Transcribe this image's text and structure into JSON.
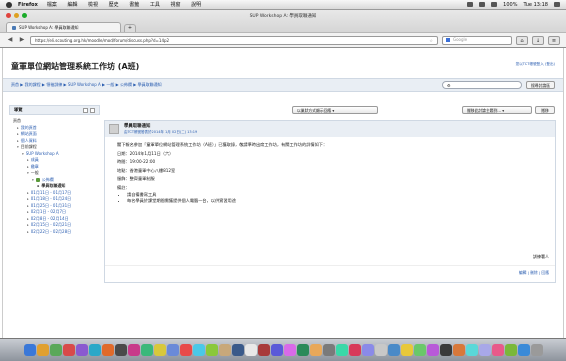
{
  "mac_menubar": {
    "app_name": "Firefox",
    "menus": [
      "檔案",
      "編輯",
      "檢視",
      "歷史",
      "書籤",
      "工具",
      "視窗",
      "說明"
    ],
    "status": "100%",
    "clock": "Tue 13:18"
  },
  "browser": {
    "window_title": "SUP Workshop A: 學員取聯通知",
    "tab_label": "SUP Workshop A: 學員取聯通知",
    "new_tab": "+",
    "url": "https://eli.scouting.org.hk/moodle/mod/forum/discuss.php?d=14p2",
    "search_placeholder": "Google"
  },
  "site": {
    "title": "童軍單位網站管理系統工作坊 (A班)",
    "login_info": "您以TCT帳號登入 (登出)",
    "breadcrumb": "頁首 ▶ 我的課程 ▶ 領袖訓練 ▶ SUP Workshop A ▶ 一般 ▶ 公佈欄 ▶ 學員取聯通知",
    "search_button": "搜尋討論區"
  },
  "sidebar": {
    "title": "導覽",
    "items": [
      {
        "label": "頁首"
      },
      {
        "label": "我的頁首"
      },
      {
        "label": "網站頁面"
      },
      {
        "label": "個人資料"
      },
      {
        "label": "目前課程"
      },
      {
        "label": "SUP Workshop A"
      },
      {
        "label": "成員"
      },
      {
        "label": "繳章"
      },
      {
        "label": "一般"
      },
      {
        "label": "公佈欄"
      },
      {
        "label": "學員取聯通知"
      },
      {
        "label": "01月11日 - 01月17日"
      },
      {
        "label": "01月18日 - 01月24日"
      },
      {
        "label": "01月25日 - 01月31日"
      },
      {
        "label": "02月1日 - 02月7日"
      },
      {
        "label": "02月8日 - 02月14日"
      },
      {
        "label": "02月15日 - 02月21日"
      },
      {
        "label": "02月22日 - 02月28日"
      }
    ]
  },
  "main": {
    "display_mode": "以巢狀方式顯示回應",
    "move_select": "搬移此討論主題到...",
    "move_button": "搬移",
    "post": {
      "title": "學員取聯通知",
      "author": "由TCT帳號發表於2014年 1月 02日(二) 13:19",
      "intro": "閣下報名參加「童軍單位網站管理系統工作坊（A班）」已獲取錄，敬請準時出席工作坊，有關工作坊的詳情如下：",
      "date": "日期：2014年1月11日（六）",
      "time": "時間：19:00-22:00",
      "venue": "地點：香港童軍中心八樓812室",
      "dress": "服飾：整齊童軍制服",
      "notes_label": "備註：",
      "notes": [
        "請自備書寫工具",
        "每名學員於課堂期間需獲提供個人電腦一台，以供實習用途"
      ],
      "signature": "訓練署人",
      "footer_links": "編輯 | 刪除 | 回應"
    }
  },
  "dock": {
    "icon_colors": [
      "#3a78d8",
      "#e0a030",
      "#5aa85a",
      "#d84a4a",
      "#8a5ad0",
      "#2aa8c8",
      "#e06a2a",
      "#4a4a4a",
      "#c83a8a",
      "#3ab87a",
      "#d8c83a",
      "#6a8ad8",
      "#e84a4a",
      "#4ac8e8",
      "#8ac83a",
      "#c8a87a",
      "#3a5a8a",
      "#e8e8e8",
      "#a83a3a",
      "#5a5ad8",
      "#d86ae8",
      "#2a8a5a",
      "#e8a85a",
      "#7a7a7a",
      "#3ad8a8",
      "#d83a5a",
      "#8a8ae8",
      "#c8c8c8",
      "#4a8ac8",
      "#e8c83a",
      "#6ac86a",
      "#b85ad8",
      "#3a3a3a",
      "#d8783a",
      "#5ad8d8",
      "#a8a8e8",
      "#e85a8a",
      "#7ab83a",
      "#3a8ad8",
      "#9a9a9a"
    ]
  }
}
